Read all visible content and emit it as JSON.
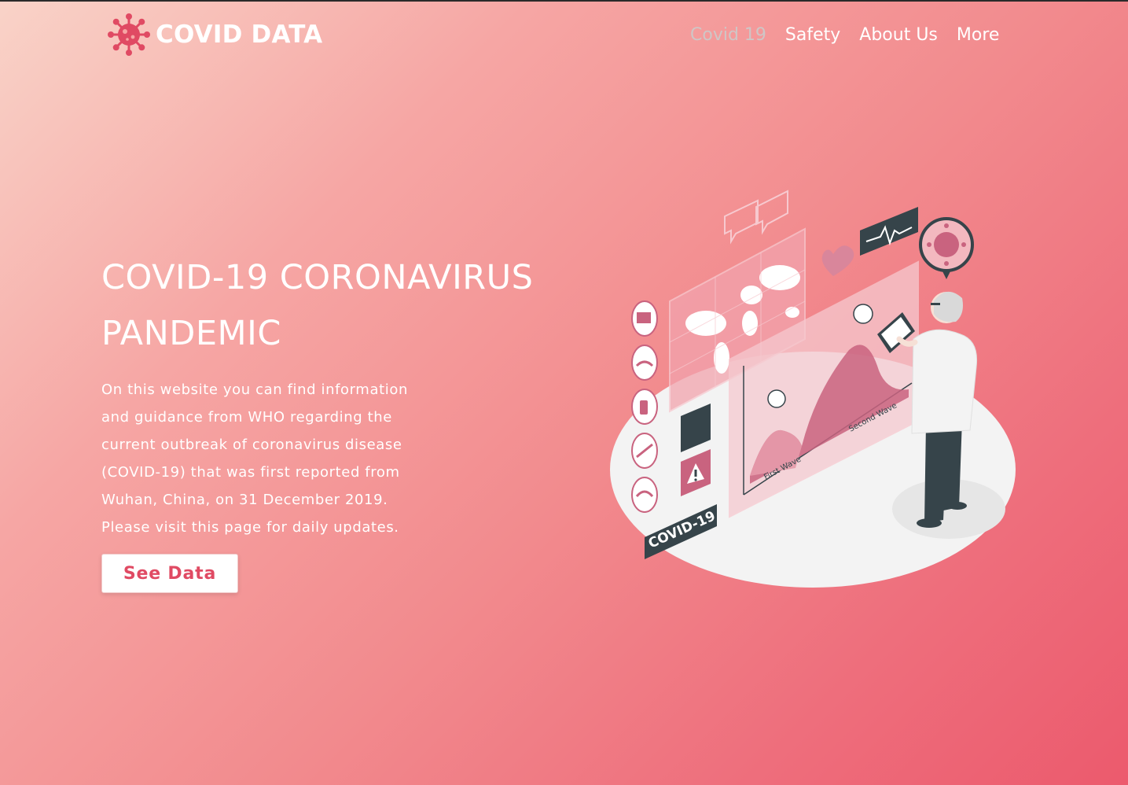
{
  "brand": {
    "name": "COVID DATA",
    "logo_icon": "virus-icon"
  },
  "nav": {
    "items": [
      {
        "label": "Covid 19",
        "active": true
      },
      {
        "label": "Safety",
        "active": false
      },
      {
        "label": "About Us",
        "active": false
      },
      {
        "label": "More",
        "active": false
      }
    ]
  },
  "hero": {
    "title_line1": "COVID-19 CORONAVIRUS",
    "title_line2": "PANDEMIC",
    "description_lines": [
      "On this website you can find information",
      "and guidance from WHO regarding the",
      "current outbreak of coronavirus disease",
      "(COVID-19) that was first reported from",
      "Wuhan, China, on 31 December 2019.",
      "Please visit this page for daily updates."
    ],
    "cta_label": "See Data"
  },
  "illustration": {
    "badge_text": "COVID-19",
    "first_wave_label": "First Wave",
    "second_wave_label": "Second Wave"
  },
  "colors": {
    "accent": "#e04a63",
    "nav_active": "#cfc6c6",
    "text": "#ffffff",
    "dark": "#36444a"
  }
}
